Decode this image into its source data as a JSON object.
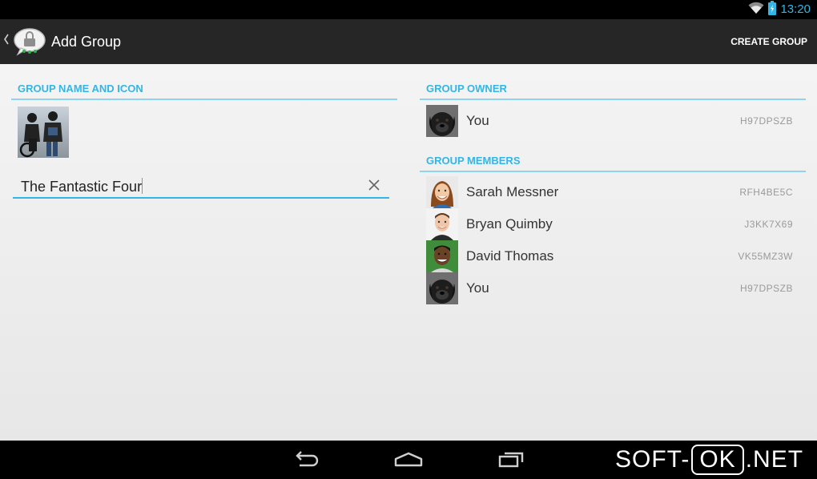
{
  "status_bar": {
    "time": "13:20",
    "icons": [
      "wifi-icon",
      "battery-icon"
    ]
  },
  "action_bar": {
    "title": "Add Group",
    "action_label": "CREATE GROUP",
    "app_icon": "chat-bubble-lock-icon"
  },
  "left_panel": {
    "header": "GROUP NAME AND ICON",
    "group_icon": "group-photo",
    "name_value": "The Fantastic Four",
    "clear_icon": "close-icon"
  },
  "right_panel": {
    "owner_header": "GROUP OWNER",
    "owner": {
      "name": "You",
      "id": "H97DPSZB",
      "avatar": "dog-avatar"
    },
    "members_header": "GROUP MEMBERS",
    "members": [
      {
        "name": "Sarah Messner",
        "id": "RFH4BE5C",
        "avatar": "woman-avatar"
      },
      {
        "name": "Bryan Quimby",
        "id": "J3KK7X69",
        "avatar": "man-avatar"
      },
      {
        "name": "David Thomas",
        "id": "VK55MZ3W",
        "avatar": "man-avatar"
      },
      {
        "name": "You",
        "id": "H97DPSZB",
        "avatar": "dog-avatar"
      }
    ]
  },
  "nav_bar": {
    "buttons": [
      "back-icon",
      "home-icon",
      "recent-apps-icon"
    ]
  },
  "watermark": {
    "left": "SOFT-",
    "box": "OK",
    "right": ".NET"
  },
  "colors": {
    "accent": "#33b5e5",
    "action_bar": "#262626",
    "background": "#f0f0f0"
  }
}
